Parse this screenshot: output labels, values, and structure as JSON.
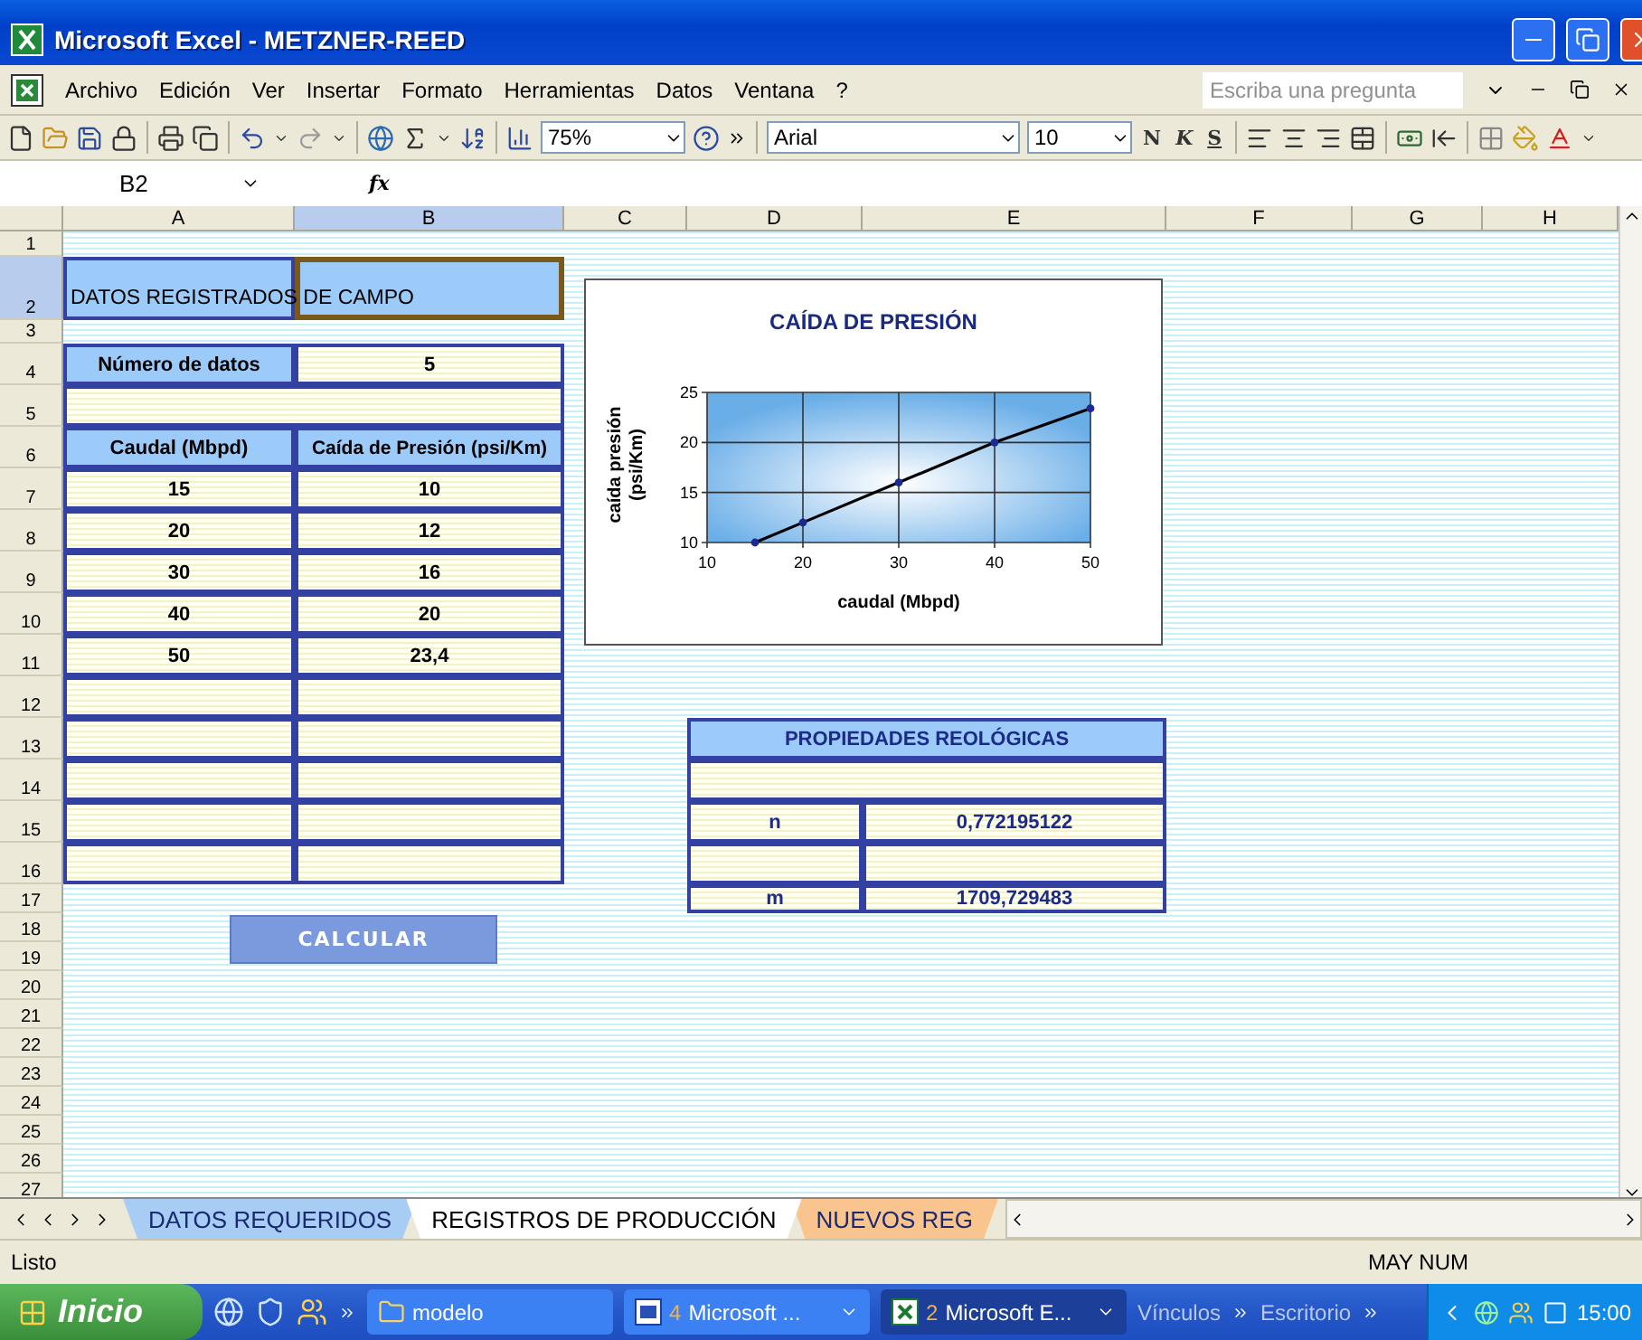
{
  "window": {
    "title": "Microsoft Excel - METZNER-REED"
  },
  "menu": [
    "Archivo",
    "Edición",
    "Ver",
    "Insertar",
    "Formato",
    "Herramientas",
    "Datos",
    "Ventana",
    "?"
  ],
  "help_search": {
    "placeholder": "Escriba una pregunta"
  },
  "toolbar": {
    "zoom": "75%",
    "font": "Arial",
    "font_size": "10",
    "format_buttons": [
      "N",
      "K",
      "S"
    ]
  },
  "formula_bar": {
    "name_box": "B2",
    "function_label": "fx"
  },
  "columns": [
    {
      "label": "A",
      "selected": false
    },
    {
      "label": "B",
      "selected": true
    },
    {
      "label": "C",
      "selected": false
    },
    {
      "label": "D",
      "selected": false
    },
    {
      "label": "E",
      "selected": false
    },
    {
      "label": "F",
      "selected": false
    },
    {
      "label": "G",
      "selected": false
    },
    {
      "label": "H",
      "selected": false
    }
  ],
  "row_headers": [
    {
      "label": "1",
      "selected": false
    },
    {
      "label": "2",
      "selected": true
    },
    {
      "label": "3",
      "selected": false
    },
    {
      "label": "4",
      "selected": false
    },
    {
      "label": "5",
      "selected": false
    },
    {
      "label": "6",
      "selected": false
    },
    {
      "label": "7",
      "selected": false
    },
    {
      "label": "8",
      "selected": false
    },
    {
      "label": "9",
      "selected": false
    },
    {
      "label": "10",
      "selected": false
    },
    {
      "label": "11",
      "selected": false
    },
    {
      "label": "12",
      "selected": false
    },
    {
      "label": "13",
      "selected": false
    },
    {
      "label": "14",
      "selected": false
    },
    {
      "label": "15",
      "selected": false
    },
    {
      "label": "16",
      "selected": false
    },
    {
      "label": "17",
      "selected": false
    },
    {
      "label": "18",
      "selected": false
    },
    {
      "label": "19",
      "selected": false
    },
    {
      "label": "20",
      "selected": false
    },
    {
      "label": "21",
      "selected": false
    },
    {
      "label": "22",
      "selected": false
    },
    {
      "label": "23",
      "selected": false
    },
    {
      "label": "24",
      "selected": false
    },
    {
      "label": "25",
      "selected": false
    },
    {
      "label": "26",
      "selected": false
    },
    {
      "label": "27",
      "selected": false
    }
  ],
  "field_table": {
    "title": "DATOS REGISTRADOS DE CAMPO",
    "count_label": "Número de datos",
    "count": "5",
    "headers": [
      "Caudal (Mbpd)",
      "Caída  de Presión (psi/Km)"
    ],
    "rows": [
      [
        "15",
        "10"
      ],
      [
        "20",
        "12"
      ],
      [
        "30",
        "16"
      ],
      [
        "40",
        "20"
      ],
      [
        "50",
        "23,4"
      ]
    ]
  },
  "chart": {
    "chart_data": {
      "type": "line",
      "title": "CAÍDA DE PRESIÓN",
      "xlabel": "caudal (Mbpd)",
      "ylabel": "caída presión (psi/Km)",
      "x": [
        15,
        20,
        30,
        40,
        50
      ],
      "series": [
        {
          "color": "#000000",
          "marker": true,
          "values": [
            10,
            12,
            16,
            20,
            23.4
          ]
        }
      ],
      "xlim": [
        10,
        50
      ],
      "ylim": [
        10,
        25
      ],
      "xticks": [
        10,
        20,
        30,
        40,
        50
      ],
      "yticks": [
        10,
        15,
        20,
        25
      ],
      "grid": true
    }
  },
  "properties": {
    "rows": [
      {
        "kind": "title",
        "label": "PROPIEDADES REOLÓGICAS"
      },
      {
        "kind": "blank"
      },
      {
        "kind": "pair",
        "label": "n",
        "value": "0,772195122"
      },
      {
        "kind": "empty_pair"
      },
      {
        "kind": "pair",
        "label": "m",
        "value": "1709,729483"
      }
    ]
  },
  "calculate_button": "CALCULAR",
  "sheet_tabs": [
    {
      "label": "DATOS REQUERIDOS",
      "selected": false,
      "color": "#a8cdf5"
    },
    {
      "label": "REGISTROS DE PRODUCCIÓN",
      "selected": true,
      "color": "#ffffff"
    },
    {
      "label": "NUEVOS REG",
      "selected": false,
      "color": "#f9c48e"
    }
  ],
  "status_bar": {
    "text": "Listo",
    "indicators": "MAY NUM"
  },
  "taskbar": {
    "start": "Inicio",
    "tasks": [
      {
        "kind": "folder",
        "label": "modelo",
        "selected": false
      },
      {
        "kind": "word",
        "count": "4",
        "label": "Microsoft ...",
        "selected": false
      },
      {
        "kind": "excel",
        "count": "2",
        "label": "Microsoft E...",
        "selected": true
      }
    ],
    "toolbars": [
      "Vínculos",
      "Escritorio"
    ],
    "clock": "15:00"
  }
}
